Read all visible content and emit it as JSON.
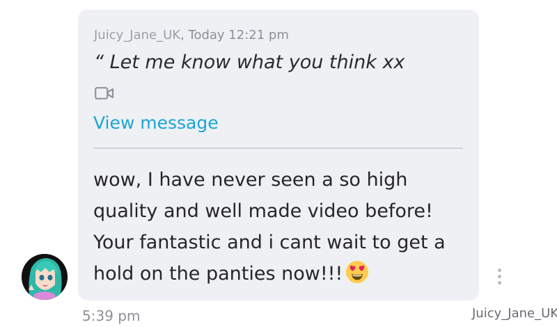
{
  "quote": {
    "username": "Juicy_Jane_UK",
    "timestamp": ", Today 12:21 pm",
    "text": "“ Let me know what you think xx",
    "attachment_icon": "video-camera-icon",
    "link_label": "View message"
  },
  "message": {
    "text": "wow, I have never seen a so high quality and well made video before! Your fantastic and i cant wait to get a hold on the panties now!!!",
    "emoji": "heart-eyes-emoji",
    "time": "5:39 pm",
    "sender": "Juicy_Jane_UK"
  },
  "colors": {
    "bubble": "#eef0f3",
    "link": "#1aa6d6",
    "divider": "#cfd3d8"
  }
}
